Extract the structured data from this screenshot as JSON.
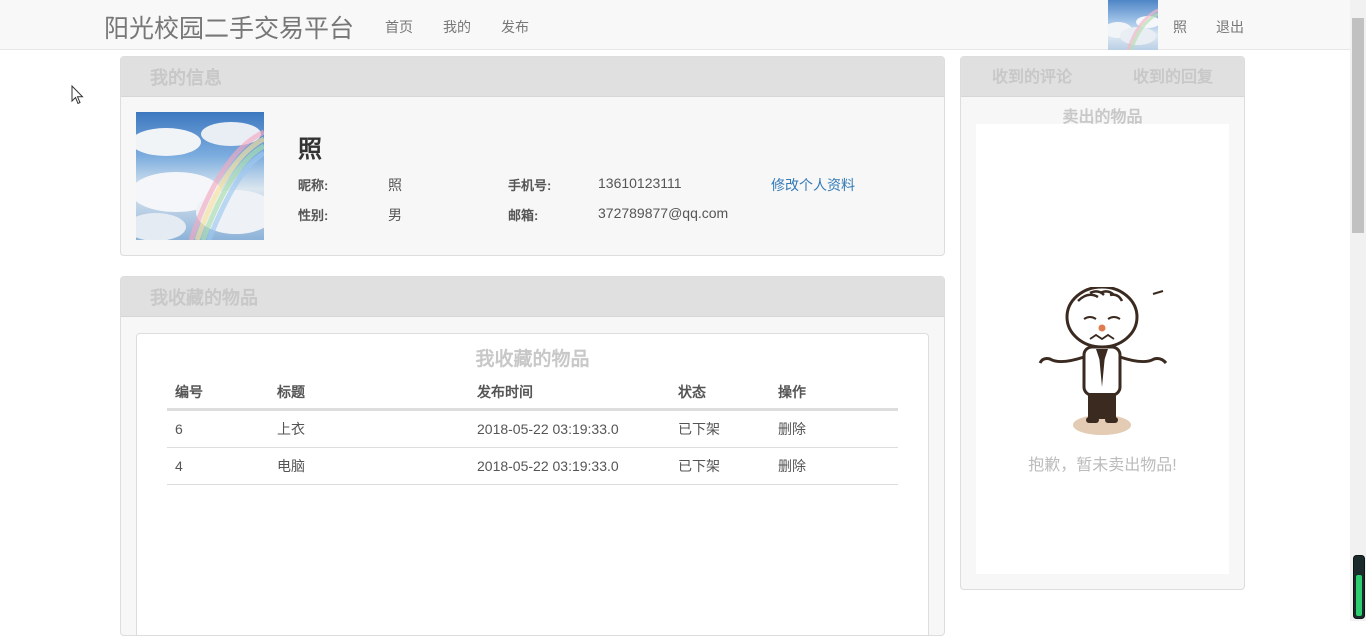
{
  "navbar": {
    "brand": "阳光校园二手交易平台",
    "links": [
      "首页",
      "我的",
      "发布"
    ],
    "username": "照",
    "logout": "退出"
  },
  "my_info": {
    "heading": "我的信息",
    "name": "照",
    "nickname_label": "昵称:",
    "nickname": "照",
    "phone_label": "手机号:",
    "phone": "13610123111",
    "edit_link": "修改个人资料",
    "gender_label": "性别:",
    "gender": "男",
    "email_label": "邮箱:",
    "email": "372789877@qq.com"
  },
  "favorites": {
    "heading": "我收藏的物品",
    "table_title": "我收藏的物品",
    "columns": [
      "编号",
      "标题",
      "发布时间",
      "状态",
      "操作"
    ],
    "rows": [
      {
        "id": "6",
        "title": "上衣",
        "time": "2018-05-22 03:19:33.0",
        "status": "已下架",
        "action": "删除"
      },
      {
        "id": "4",
        "title": "电脑",
        "time": "2018-05-22 03:19:33.0",
        "status": "已下架",
        "action": "删除"
      }
    ]
  },
  "side": {
    "tabs": [
      "收到的评论",
      "收到的回复"
    ],
    "sold_title": "卖出的物品",
    "empty_message": "抱歉，暂未卖出物品!"
  },
  "icons": {
    "cursor": "mouse-pointer-icon",
    "empty_illustration": "shrugging-man-icon"
  },
  "colors": {
    "link": "#337ab7",
    "panel_heading_bg": "#e0e0e0",
    "navbar_bg": "#f8f8f8"
  }
}
